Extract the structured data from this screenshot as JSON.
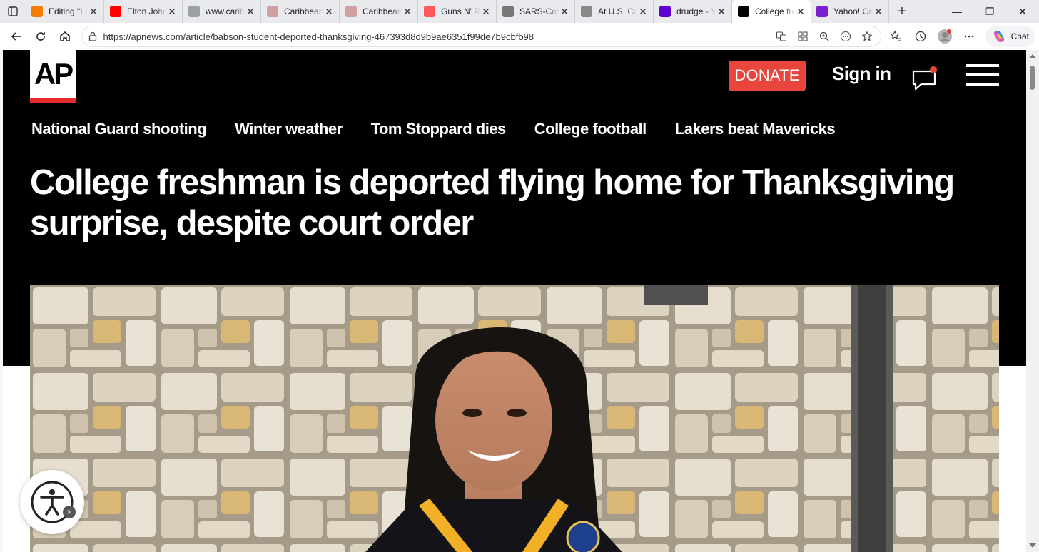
{
  "browser": {
    "tabs": [
      {
        "title": "Editing \"I c",
        "icon": "blogger-icon",
        "color": "#f57d00"
      },
      {
        "title": "Elton John",
        "icon": "youtube-icon",
        "color": "#ff0000"
      },
      {
        "title": "www.carib",
        "icon": "search-icon",
        "color": "#9aa0a6"
      },
      {
        "title": "Caribbean",
        "icon": "wiki-icon",
        "color": "#d0a0a0"
      },
      {
        "title": "Caribbean",
        "icon": "wiki-icon",
        "color": "#d0a0a0"
      },
      {
        "title": "Guns N' Ro",
        "icon": "youtube-icon",
        "color": "#ff5a5a"
      },
      {
        "title": "SARS-CoV",
        "icon": "fp-icon",
        "color": "#777"
      },
      {
        "title": "At U.S. Co",
        "icon": "gp-icon",
        "color": "#888"
      },
      {
        "title": "drudge - Y",
        "icon": "yahoo-icon",
        "color": "#5f01d1"
      },
      {
        "title": "College fre",
        "icon": "ap-icon",
        "color": "#000",
        "active": true
      },
      {
        "title": "Yahoo! Ca",
        "icon": "yahoo-icon",
        "color": "#7b1fd1"
      }
    ],
    "url": "https://apnews.com/article/babson-student-deported-thanksgiving-467393d8d9b9ae6351f99de7b9cbfb98",
    "chat_label": "Chat"
  },
  "site": {
    "logo_text": "AP",
    "donate_label": "DONATE",
    "signin_label": "Sign in",
    "nav": [
      "National Guard shooting",
      "Winter weather",
      "Tom Stoppard dies",
      "College football",
      "Lakers beat Mavericks"
    ],
    "headline": "College freshman is deported flying home for Thanksgiving surprise, despite court order",
    "colors": {
      "accent": "#e8453c",
      "background": "#000000"
    }
  }
}
